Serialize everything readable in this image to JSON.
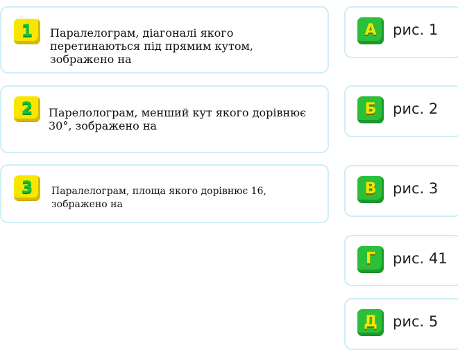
{
  "questions": [
    {
      "number": "1",
      "text": "Паралелограм, діагоналі якого перетинаються під прямим кутом, зображено на"
    },
    {
      "number": "2",
      "text": "Парелолограм, менший кут якого дорівнює 30°, зображено на"
    },
    {
      "number": "3",
      "text": "Паралелограм, площа якого дорівнює 16, зображено на"
    }
  ],
  "answers": [
    {
      "letter": "А",
      "label": "рис. 1"
    },
    {
      "letter": "Б",
      "label": "рис. 2"
    },
    {
      "letter": "В",
      "label": "рис. 3"
    },
    {
      "letter": "Г",
      "label": "рис. 41"
    },
    {
      "letter": "Д",
      "label": "рис. 5"
    }
  ],
  "colors": {
    "card_border": "#cdeef7",
    "number_badge": "#f9e600",
    "number_text": "#15c13a",
    "letter_badge": "#2cbf3a",
    "letter_text": "#f5e600"
  }
}
